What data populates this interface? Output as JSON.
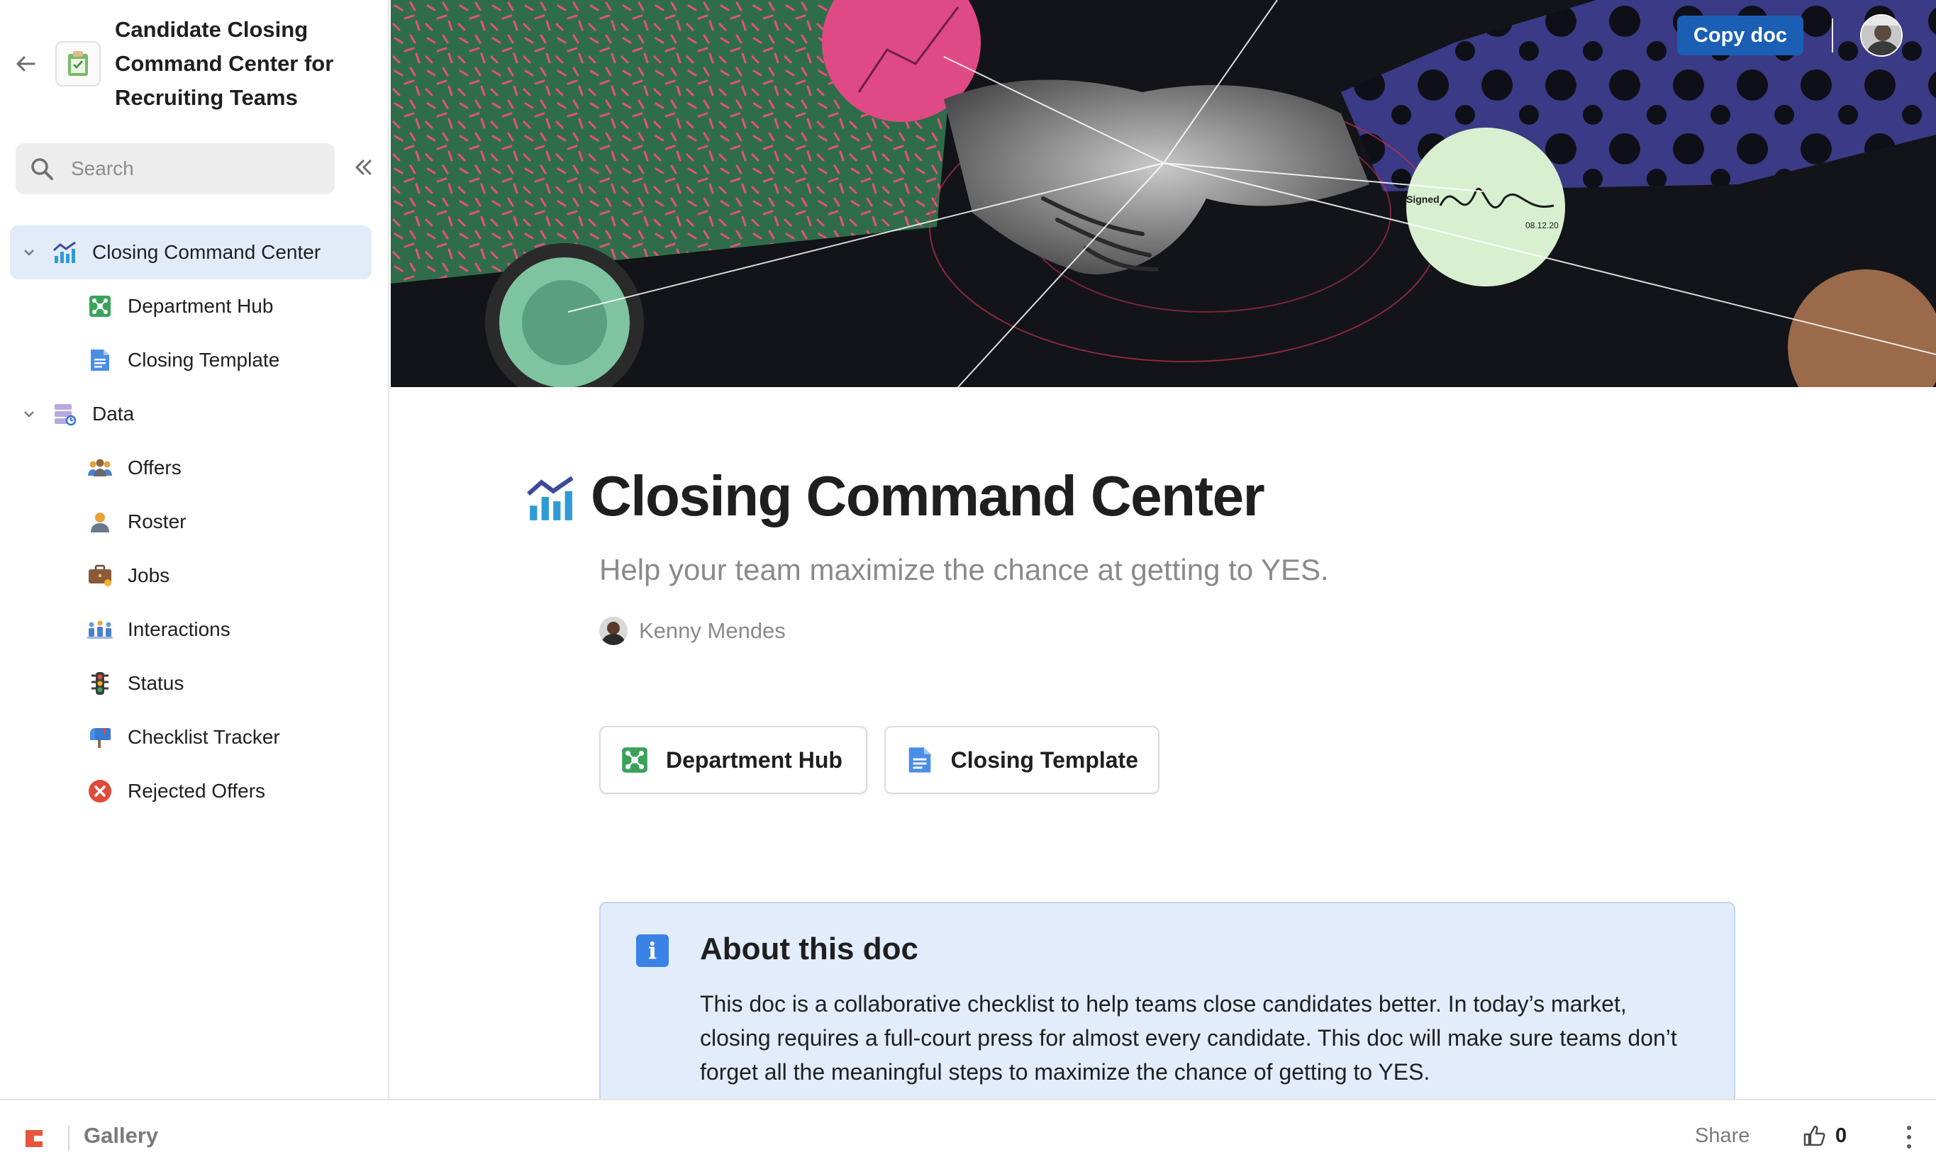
{
  "doc": {
    "title": "Candidate Closing Command Center for Recruiting Teams"
  },
  "search": {
    "placeholder": "Search"
  },
  "sidebar": {
    "items": [
      {
        "label": "Closing Command Center",
        "icon": "chart-icon",
        "active": true
      },
      {
        "label": "Department Hub",
        "icon": "hub-icon"
      },
      {
        "label": "Closing Template",
        "icon": "document-icon"
      },
      {
        "label": "Data",
        "icon": "database-icon"
      },
      {
        "label": "Offers",
        "icon": "people-icon"
      },
      {
        "label": "Roster",
        "icon": "person-icon"
      },
      {
        "label": "Jobs",
        "icon": "briefcase-icon"
      },
      {
        "label": "Interactions",
        "icon": "interactions-icon"
      },
      {
        "label": "Status",
        "icon": "traffic-light-icon"
      },
      {
        "label": "Checklist Tracker",
        "icon": "mailbox-icon"
      },
      {
        "label": "Rejected Offers",
        "icon": "x-circle-icon"
      }
    ]
  },
  "header": {
    "copy_label": "Copy doc"
  },
  "page": {
    "title": "Closing Command Center",
    "subtitle": "Help your team maximize the chance at getting to YES.",
    "author": "Kenny Mendes",
    "hero_signature": "Signed",
    "hero_date": "08.12.20",
    "links": [
      {
        "label": "Department Hub",
        "icon": "hub-icon"
      },
      {
        "label": "Closing Template",
        "icon": "document-icon"
      }
    ],
    "callout": {
      "heading": "About this doc",
      "body": "This doc is a collaborative checklist to help teams close candidates better. In today’s market, closing requires a full-court press for almost every candidate. This doc will make sure teams don’t forget all the meaningful steps to maximize the chance of getting to YES."
    }
  },
  "footer": {
    "gallery": "Gallery",
    "share": "Share",
    "likes": "0"
  },
  "colors": {
    "accent": "#1a5fb4",
    "active_nav": "#e1ecf8",
    "callout_bg": "#e2ecfb",
    "info_icon": "#3b82e6"
  }
}
